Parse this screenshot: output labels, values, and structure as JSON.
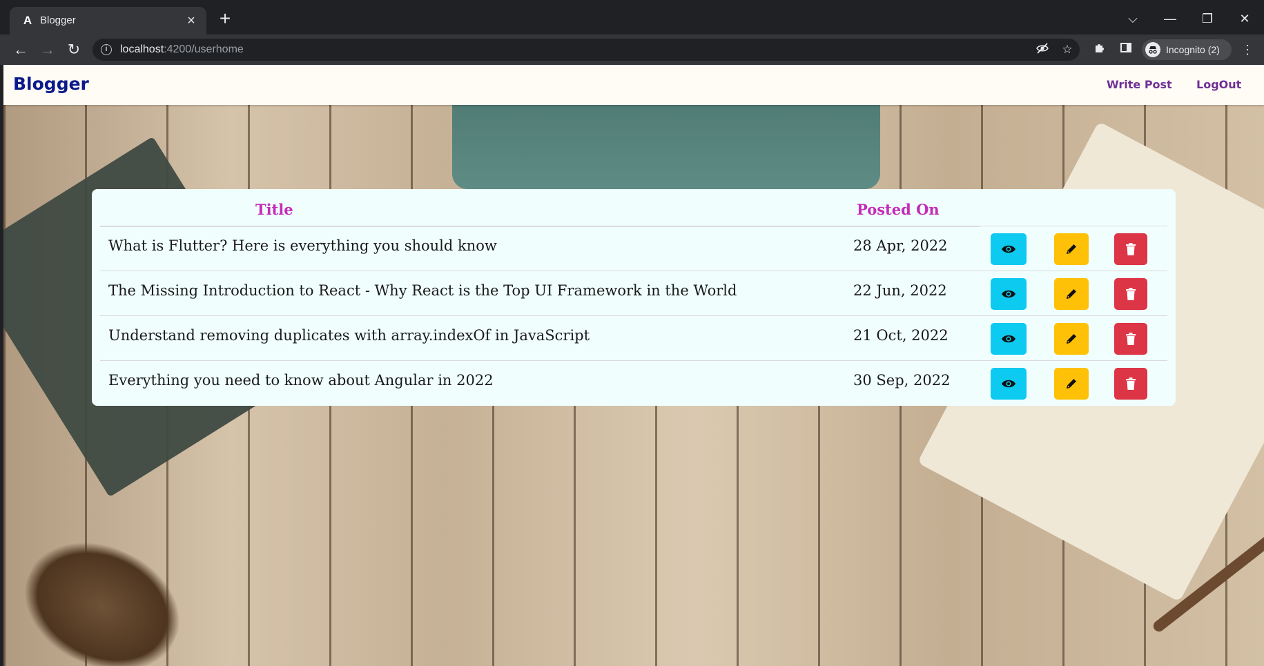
{
  "browser": {
    "tab_title": "Blogger",
    "tab_favicon": "A",
    "url_host": "localhost",
    "url_path": ":4200/userhome",
    "profile_label": "Incognito (2)"
  },
  "navbar": {
    "brand": "Blogger",
    "links": [
      "Write Post",
      "LogOut"
    ]
  },
  "table": {
    "headers": [
      "Title",
      "Posted On"
    ],
    "rows": [
      {
        "title": "What is Flutter? Here is everything you should know",
        "posted_on": "28 Apr, 2022"
      },
      {
        "title": "The Missing Introduction to React - Why React is the Top UI Framework in the World",
        "posted_on": "22 Jun, 2022"
      },
      {
        "title": "Understand removing duplicates with array.indexOf in JavaScript",
        "posted_on": "21 Oct, 2022"
      },
      {
        "title": "Everything you need to know about Angular in 2022",
        "posted_on": "30 Sep, 2022"
      }
    ],
    "actions": [
      {
        "name": "view",
        "icon": "eye-icon",
        "color": "#0dcaf0"
      },
      {
        "name": "edit",
        "icon": "pencil-icon",
        "color": "#ffc107"
      },
      {
        "name": "delete",
        "icon": "trash-icon",
        "color": "#dc3545"
      }
    ]
  },
  "colors": {
    "brand": "#0b1a8a",
    "nav_link": "#6f3096",
    "header_text": "#c42cb8",
    "card_bg": "#f0fefd"
  }
}
